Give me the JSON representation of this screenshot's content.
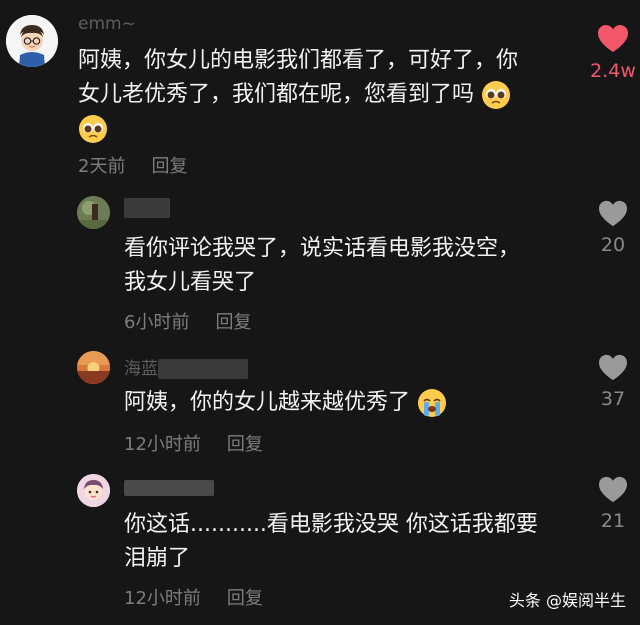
{
  "colors": {
    "background": "#161616",
    "like_active": "#f4576a",
    "like_inactive": "#9a9a9a",
    "text": "#f2f2f2",
    "meta": "#7d7d7d"
  },
  "comments": [
    {
      "username": "emm~",
      "text_line1": "阿姨，你女儿的电影我们都看了，可好了，你",
      "text_line2": "女儿老优秀了，我们都在呢，您看到了吗",
      "time": "2天前",
      "reply_label": "回复",
      "likes": "2.4w",
      "emoji": "pleading-face-icon"
    },
    {
      "username": "",
      "text_line1": "看你评论我哭了，说实话看电影我没空，",
      "text_line2": "我女儿看哭了",
      "time": "6小时前",
      "reply_label": "回复",
      "likes": "20"
    },
    {
      "username": "海蓝",
      "text_line1": "阿姨，你的女儿越来越优秀了",
      "time": "12小时前",
      "reply_label": "回复",
      "likes": "37",
      "emoji": "crying-face-icon"
    },
    {
      "username": "",
      "text_line1": "你这话...........看电影我没哭 你这话我都要",
      "text_line2": "泪崩了",
      "time": "12小时前",
      "reply_label": "回复",
      "likes": "21"
    }
  ],
  "watermark": "头条 @娱阅半生"
}
